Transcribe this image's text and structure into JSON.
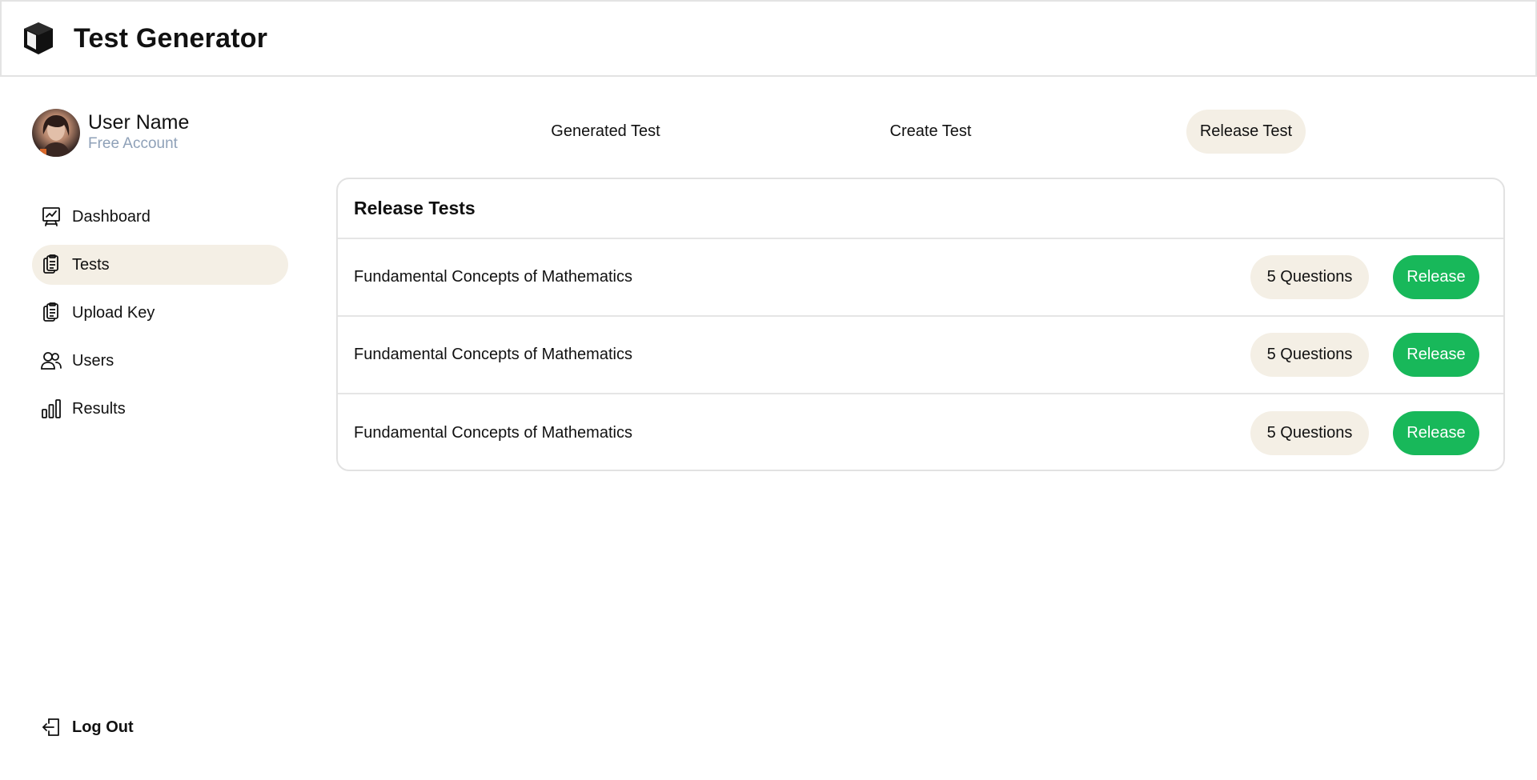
{
  "app": {
    "title": "Test Generator",
    "logo_icon": "cube-icon"
  },
  "profile": {
    "name": "User Name",
    "account": "Free Account"
  },
  "sidebar": {
    "items": [
      {
        "label": "Dashboard",
        "icon": "presentation-chart-icon",
        "active": false
      },
      {
        "label": "Tests",
        "icon": "clipboard-icon",
        "active": true
      },
      {
        "label": "Upload Key",
        "icon": "clipboard-icon",
        "active": false
      },
      {
        "label": "Users",
        "icon": "users-icon",
        "active": false
      },
      {
        "label": "Results",
        "icon": "bar-chart-icon",
        "active": false
      }
    ],
    "logout": {
      "label": "Log Out",
      "icon": "logout-icon"
    }
  },
  "tabs": [
    {
      "label": "Generated Test",
      "active": false
    },
    {
      "label": "Create Test",
      "active": false
    },
    {
      "label": "Release Test",
      "active": true
    }
  ],
  "release": {
    "title": "Release Tests",
    "rows": [
      {
        "name": "Fundamental Concepts of Mathematics",
        "questions": "5 Questions",
        "action": "Release"
      },
      {
        "name": "Fundamental Concepts of Mathematics",
        "questions": "5 Questions",
        "action": "Release"
      },
      {
        "name": "Fundamental Concepts of Mathematics",
        "questions": "5 Questions",
        "action": "Release"
      }
    ]
  },
  "colors": {
    "accent": "#18b85a",
    "highlight": "#f4efe5",
    "muted": "#8fa1b8"
  }
}
